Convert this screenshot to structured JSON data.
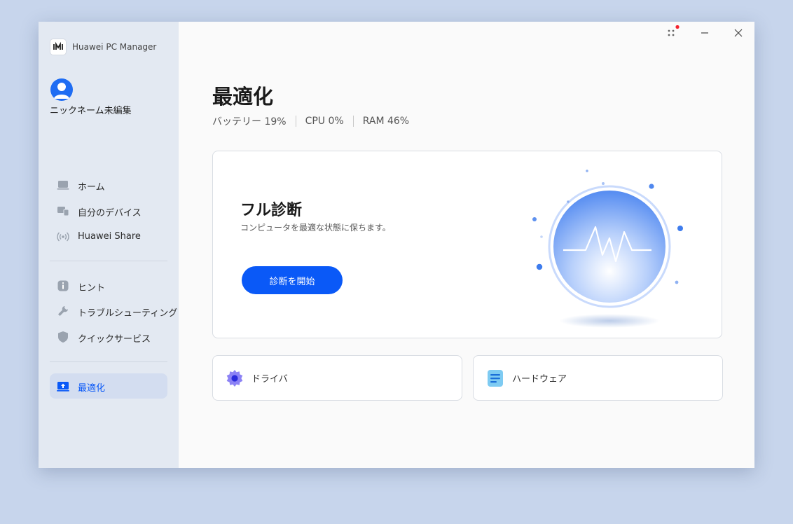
{
  "app": {
    "title": "Huawei PC Manager"
  },
  "user": {
    "nickname": "ニックネーム未編集"
  },
  "sidebar": {
    "group1": [
      {
        "label": "ホーム",
        "icon": "laptop-icon"
      },
      {
        "label": "自分のデバイス",
        "icon": "devices-icon"
      },
      {
        "label": "Huawei Share",
        "icon": "share-wireless-icon"
      }
    ],
    "group2": [
      {
        "label": "ヒント",
        "icon": "info-icon"
      },
      {
        "label": "トラブルシューティング",
        "icon": "wrench-icon"
      },
      {
        "label": "クイックサービス",
        "icon": "shield-icon"
      }
    ],
    "active": {
      "label": "最適化",
      "icon": "optimize-icon"
    }
  },
  "titlebar": {
    "menu_icon": "menu-dots-icon",
    "notification_dot_color": "#f5222d"
  },
  "main": {
    "title": "最適化",
    "stats": {
      "battery": "バッテリー 19%",
      "cpu": "CPU 0%",
      "ram": "RAM 46%"
    },
    "diagnosis": {
      "title": "フル診断",
      "subtitle": "コンピュータを最適な状態に保ちます。",
      "button_label": "診断を開始"
    },
    "cards": [
      {
        "label": "ドライバ",
        "icon": "gear-icon"
      },
      {
        "label": "ハードウェア",
        "icon": "hardware-doc-icon"
      }
    ]
  },
  "colors": {
    "accent": "#0a59f7",
    "sidebar_bg": "#e3e9f2",
    "window_bg": "#fafafa",
    "desktop_bg": "#c7d5ec"
  }
}
